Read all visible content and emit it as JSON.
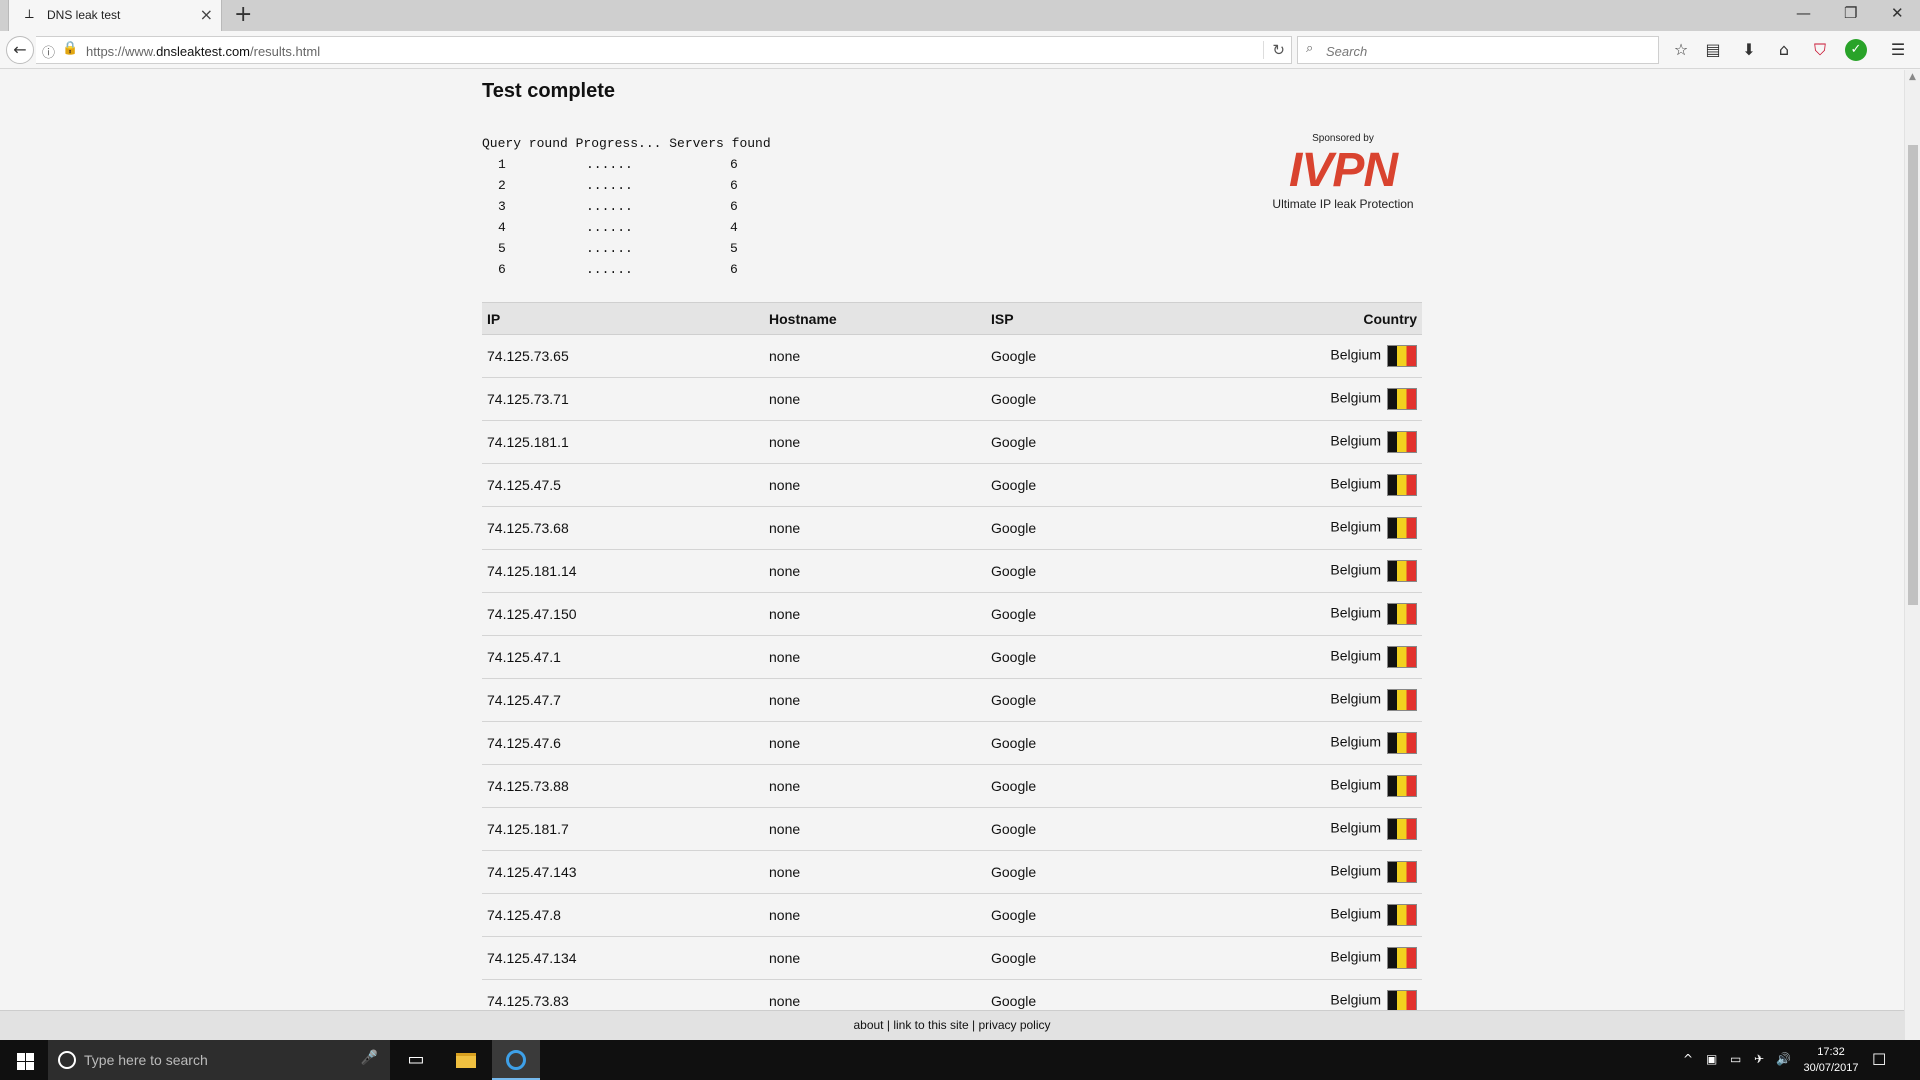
{
  "browser": {
    "tab_title": "DNS leak test",
    "tab_favicon": "⟂",
    "tab_close": "×",
    "new_tab": "+",
    "minimize": "—",
    "restore": "❐",
    "close": "✕",
    "url_domain": "https://www.",
    "url_host": "dnsleaktest.com",
    "url_path": "/results.html",
    "search_placeholder": "Search",
    "icons": {
      "back": "←",
      "info": "ⓘ",
      "lock": "🔒",
      "reload": "↻",
      "search": "⌕",
      "bookmark": "☆",
      "library": "▤",
      "download": "⬇",
      "home": "⌂",
      "shield": "⛉",
      "check": "✓",
      "menu": "☰"
    }
  },
  "page": {
    "title": "Test complete",
    "progress_header": "Query round Progress... Servers found",
    "progress_rows": [
      {
        "round": "1",
        "dots": "......",
        "servers": "6"
      },
      {
        "round": "2",
        "dots": "......",
        "servers": "6"
      },
      {
        "round": "3",
        "dots": "......",
        "servers": "6"
      },
      {
        "round": "4",
        "dots": "......",
        "servers": "4"
      },
      {
        "round": "5",
        "dots": "......",
        "servers": "5"
      },
      {
        "round": "6",
        "dots": "......",
        "servers": "6"
      }
    ],
    "sponsor": {
      "label": "Sponsored by",
      "logo": "IVPN",
      "tagline": "Ultimate IP leak Protection"
    },
    "table": {
      "columns": [
        "IP",
        "Hostname",
        "ISP",
        "Country"
      ],
      "rows": [
        {
          "ip": "74.125.73.65",
          "hostname": "none",
          "isp": "Google",
          "country": "Belgium"
        },
        {
          "ip": "74.125.73.71",
          "hostname": "none",
          "isp": "Google",
          "country": "Belgium"
        },
        {
          "ip": "74.125.181.1",
          "hostname": "none",
          "isp": "Google",
          "country": "Belgium"
        },
        {
          "ip": "74.125.47.5",
          "hostname": "none",
          "isp": "Google",
          "country": "Belgium"
        },
        {
          "ip": "74.125.73.68",
          "hostname": "none",
          "isp": "Google",
          "country": "Belgium"
        },
        {
          "ip": "74.125.181.14",
          "hostname": "none",
          "isp": "Google",
          "country": "Belgium"
        },
        {
          "ip": "74.125.47.150",
          "hostname": "none",
          "isp": "Google",
          "country": "Belgium"
        },
        {
          "ip": "74.125.47.1",
          "hostname": "none",
          "isp": "Google",
          "country": "Belgium"
        },
        {
          "ip": "74.125.47.7",
          "hostname": "none",
          "isp": "Google",
          "country": "Belgium"
        },
        {
          "ip": "74.125.47.6",
          "hostname": "none",
          "isp": "Google",
          "country": "Belgium"
        },
        {
          "ip": "74.125.73.88",
          "hostname": "none",
          "isp": "Google",
          "country": "Belgium"
        },
        {
          "ip": "74.125.181.7",
          "hostname": "none",
          "isp": "Google",
          "country": "Belgium"
        },
        {
          "ip": "74.125.47.143",
          "hostname": "none",
          "isp": "Google",
          "country": "Belgium"
        },
        {
          "ip": "74.125.47.8",
          "hostname": "none",
          "isp": "Google",
          "country": "Belgium"
        },
        {
          "ip": "74.125.47.134",
          "hostname": "none",
          "isp": "Google",
          "country": "Belgium"
        },
        {
          "ip": "74.125.73.83",
          "hostname": "none",
          "isp": "Google",
          "country": "Belgium"
        }
      ]
    },
    "footer": {
      "about": "about",
      "link": "link to this site",
      "privacy": "privacy policy",
      "separator": " | "
    }
  },
  "taskbar": {
    "search_placeholder": "Type here to search",
    "time": "17:32",
    "date": "30/07/2017",
    "icons": {
      "mic": "🎤",
      "task_view": "▭",
      "tray_up": "^",
      "network": "▣",
      "battery": "▭",
      "airplane": "✈",
      "volume": "🔊",
      "notifications": "☐"
    }
  },
  "colors": {
    "accent_logo": "#d9432f",
    "flag_black": "#111111",
    "flag_yellow": "#f2d11f",
    "flag_red": "#e2322d"
  }
}
